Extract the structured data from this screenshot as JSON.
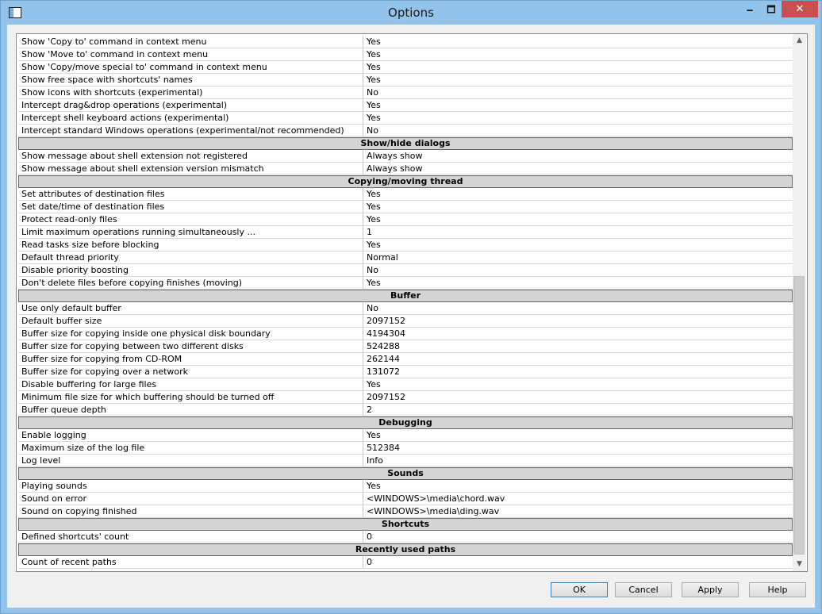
{
  "window": {
    "title": "Options"
  },
  "titlebar": {
    "minimize": "🗕",
    "maximize": "🗖",
    "close": "✕"
  },
  "grid": {
    "rows": [
      {
        "type": "row",
        "key": "Show 'Copy to' command in context menu",
        "value": "Yes"
      },
      {
        "type": "row",
        "key": "Show 'Move to' command in context menu",
        "value": "Yes"
      },
      {
        "type": "row",
        "key": "Show 'Copy/move special to' command in context menu",
        "value": "Yes"
      },
      {
        "type": "row",
        "key": "Show free space with shortcuts' names",
        "value": "Yes"
      },
      {
        "type": "row",
        "key": "Show icons with shortcuts (experimental)",
        "value": "No"
      },
      {
        "type": "row",
        "key": "Intercept drag&drop operations (experimental)",
        "value": "Yes"
      },
      {
        "type": "row",
        "key": "Intercept shell keyboard actions (experimental)",
        "value": "Yes"
      },
      {
        "type": "row",
        "key": "Intercept standard Windows operations (experimental/not recommended)",
        "value": "No"
      },
      {
        "type": "header",
        "title": "Show/hide dialogs"
      },
      {
        "type": "row",
        "key": "Show message about shell extension not registered",
        "value": "Always show"
      },
      {
        "type": "row",
        "key": "Show message about shell extension version mismatch",
        "value": "Always show"
      },
      {
        "type": "header",
        "title": "Copying/moving thread"
      },
      {
        "type": "row",
        "key": "Set attributes of destination files",
        "value": "Yes"
      },
      {
        "type": "row",
        "key": "Set date/time of destination files",
        "value": "Yes"
      },
      {
        "type": "row",
        "key": "Protect read-only files",
        "value": "Yes"
      },
      {
        "type": "row",
        "key": "Limit maximum operations running simultaneously ...",
        "value": "1"
      },
      {
        "type": "row",
        "key": "Read tasks size before blocking",
        "value": "Yes"
      },
      {
        "type": "row",
        "key": "Default thread priority",
        "value": "Normal"
      },
      {
        "type": "row",
        "key": "Disable priority boosting",
        "value": "No"
      },
      {
        "type": "row",
        "key": "Don't delete files before copying finishes (moving)",
        "value": "Yes"
      },
      {
        "type": "header",
        "title": "Buffer"
      },
      {
        "type": "row",
        "key": "Use only default buffer",
        "value": "No"
      },
      {
        "type": "row",
        "key": "Default buffer size",
        "value": "2097152"
      },
      {
        "type": "row",
        "key": "Buffer size for copying inside one physical disk boundary",
        "value": "4194304"
      },
      {
        "type": "row",
        "key": "Buffer size for copying between two different disks",
        "value": "524288"
      },
      {
        "type": "row",
        "key": "Buffer size for copying from CD-ROM",
        "value": "262144"
      },
      {
        "type": "row",
        "key": "Buffer size for copying over a network",
        "value": "131072"
      },
      {
        "type": "row",
        "key": "Disable buffering for large files",
        "value": "Yes"
      },
      {
        "type": "row",
        "key": "Minimum file size for which buffering should be turned off",
        "value": "2097152"
      },
      {
        "type": "row",
        "key": "Buffer queue depth",
        "value": "2"
      },
      {
        "type": "header",
        "title": "Debugging"
      },
      {
        "type": "row",
        "key": "Enable logging",
        "value": "Yes"
      },
      {
        "type": "row",
        "key": "Maximum size of the log file",
        "value": "512384"
      },
      {
        "type": "row",
        "key": "Log level",
        "value": "Info"
      },
      {
        "type": "header",
        "title": "Sounds"
      },
      {
        "type": "row",
        "key": "Playing sounds",
        "value": "Yes"
      },
      {
        "type": "row",
        "key": "Sound on error",
        "value": "<WINDOWS>\\media\\chord.wav"
      },
      {
        "type": "row",
        "key": "Sound on copying finished",
        "value": "<WINDOWS>\\media\\ding.wav"
      },
      {
        "type": "header",
        "title": "Shortcuts"
      },
      {
        "type": "row",
        "key": "Defined shortcuts' count",
        "value": "0"
      },
      {
        "type": "header",
        "title": "Recently used paths"
      },
      {
        "type": "row",
        "key": "Count of recent paths",
        "value": "0"
      }
    ]
  },
  "scrollbar": {
    "up": "▲",
    "down": "▼"
  },
  "buttons": {
    "ok": "OK",
    "cancel": "Cancel",
    "apply": "Apply",
    "help": "Help"
  },
  "colors": {
    "title_bg": "#93c3eb",
    "header_row_bg": "#d4d4d4",
    "close_bg": "#c75050"
  }
}
